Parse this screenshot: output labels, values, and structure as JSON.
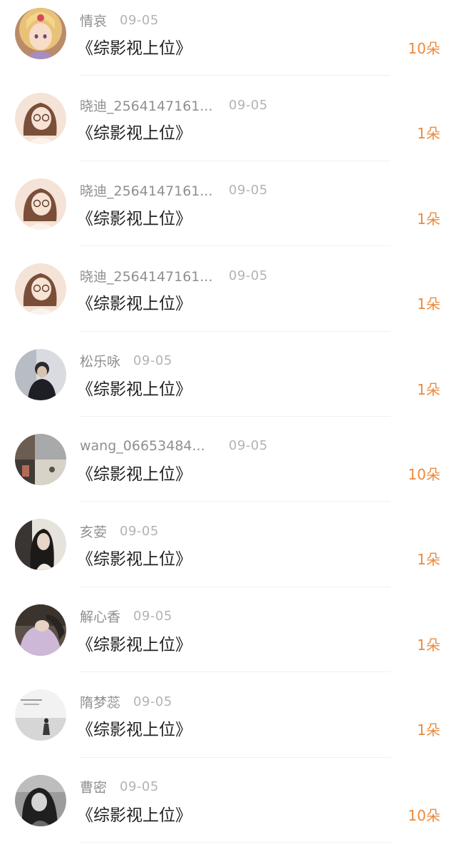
{
  "comments": [
    {
      "name": "情哀",
      "date": "09-05",
      "title": "《综影视上位》",
      "count": "10朵",
      "avatar": "anime-girl-gold-icon",
      "long": false
    },
    {
      "name": "晓迪_2564147161...",
      "date": "09-05",
      "title": "《综影视上位》",
      "count": "1朵",
      "avatar": "girl-glasses-illustration-icon",
      "long": true
    },
    {
      "name": "晓迪_2564147161...",
      "date": "09-05",
      "title": "《综影视上位》",
      "count": "1朵",
      "avatar": "girl-glasses-illustration-icon",
      "long": true
    },
    {
      "name": "晓迪_2564147161...",
      "date": "09-05",
      "title": "《综影视上位》",
      "count": "1朵",
      "avatar": "girl-glasses-illustration-icon",
      "long": true
    },
    {
      "name": "松乐咏",
      "date": "09-05",
      "title": "《综影视上位》",
      "count": "1朵",
      "avatar": "boy-photo-icon",
      "long": false
    },
    {
      "name": "wang_06653484...",
      "date": "09-05",
      "title": "《综影视上位》",
      "count": "10朵",
      "avatar": "collage-photo-icon",
      "long": true
    },
    {
      "name": "亥荌",
      "date": "09-05",
      "title": "《综影视上位》",
      "count": "1朵",
      "avatar": "woman-dark-photo-icon",
      "long": false
    },
    {
      "name": "解心香",
      "date": "09-05",
      "title": "《综影视上位》",
      "count": "1朵",
      "avatar": "woman-sweater-photo-icon",
      "long": false
    },
    {
      "name": "隋梦蕊",
      "date": "09-05",
      "title": "《综影视上位》",
      "count": "1朵",
      "avatar": "beach-silhouette-photo-icon",
      "long": false
    },
    {
      "name": "曹密",
      "date": "09-05",
      "title": "《综影视上位》",
      "count": "10朵",
      "avatar": "woman-bw-photo-icon",
      "long": false
    }
  ],
  "colors": {
    "count": "#ec8a3c",
    "name": "#8f8f8f",
    "date": "#b3b3b3",
    "title": "#222222"
  }
}
